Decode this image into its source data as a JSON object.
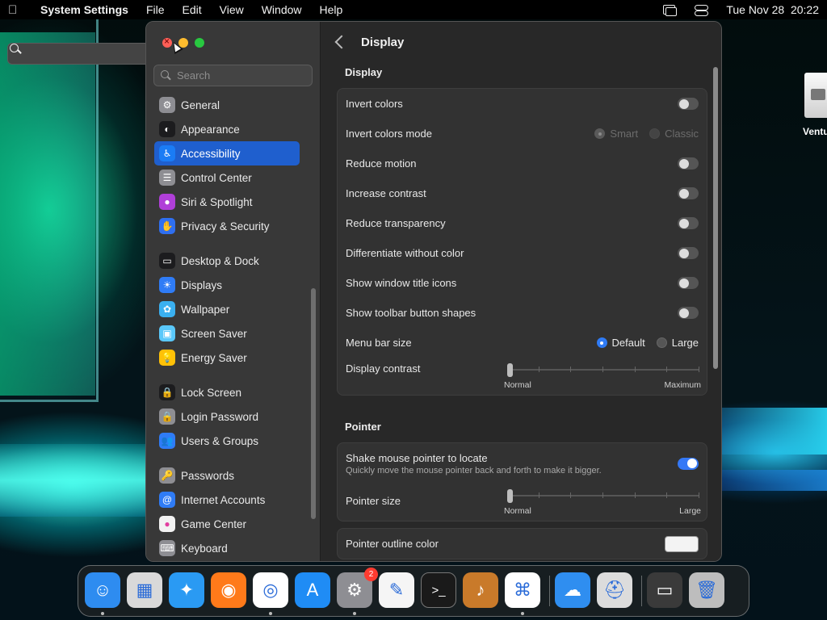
{
  "menubar": {
    "app_name": "System Settings",
    "menus": [
      "File",
      "Edit",
      "View",
      "Window",
      "Help"
    ],
    "clock": "Tue Nov 28  20:22"
  },
  "desktop": {
    "volume_label": "Ventur"
  },
  "sidebar": {
    "search_placeholder": "Search",
    "items": [
      {
        "label": "General",
        "icon": "gear-icon",
        "color": "#8e8e93"
      },
      {
        "label": "Appearance",
        "icon": "appearance-icon",
        "color": "#1c1c1e"
      },
      {
        "label": "Accessibility",
        "icon": "accessibility-icon",
        "color": "#1a7cf5",
        "active": true
      },
      {
        "label": "Control Center",
        "icon": "control-center-icon",
        "color": "#8e8e93"
      },
      {
        "label": "Siri & Spotlight",
        "icon": "siri-icon",
        "color": "#b03fd8"
      },
      {
        "label": "Privacy & Security",
        "icon": "hand-icon",
        "color": "#2f6ff0"
      },
      {
        "label": "Desktop & Dock",
        "icon": "dock-icon",
        "color": "#1c1c1e"
      },
      {
        "label": "Displays",
        "icon": "sun-icon",
        "color": "#2f7cf6"
      },
      {
        "label": "Wallpaper",
        "icon": "wallpaper-icon",
        "color": "#3ab0f0"
      },
      {
        "label": "Screen Saver",
        "icon": "screen-saver-icon",
        "color": "#5ac8fa"
      },
      {
        "label": "Energy Saver",
        "icon": "bulb-icon",
        "color": "#ffc107"
      },
      {
        "label": "Lock Screen",
        "icon": "lock-icon",
        "color": "#1c1c1e"
      },
      {
        "label": "Login Password",
        "icon": "lock-icon",
        "color": "#8e8e93"
      },
      {
        "label": "Users & Groups",
        "icon": "users-icon",
        "color": "#2f7cf6"
      },
      {
        "label": "Passwords",
        "icon": "key-icon",
        "color": "#8e8e93"
      },
      {
        "label": "Internet Accounts",
        "icon": "at-icon",
        "color": "#2f7cf6"
      },
      {
        "label": "Game Center",
        "icon": "game-center-icon",
        "color": "#f2f2f2"
      },
      {
        "label": "Keyboard",
        "icon": "keyboard-icon",
        "color": "#8e8e93"
      }
    ]
  },
  "main": {
    "title": "Display",
    "display_section": {
      "heading": "Display",
      "rows": [
        {
          "label": "Invert colors",
          "type": "toggle",
          "on": false
        },
        {
          "label": "Invert colors mode",
          "type": "radio",
          "options": [
            "Smart",
            "Classic"
          ],
          "selected": "Smart",
          "disabled": true
        },
        {
          "label": "Reduce motion",
          "type": "toggle",
          "on": false
        },
        {
          "label": "Increase contrast",
          "type": "toggle",
          "on": false
        },
        {
          "label": "Reduce transparency",
          "type": "toggle",
          "on": false
        },
        {
          "label": "Differentiate without color",
          "type": "toggle",
          "on": false
        },
        {
          "label": "Show window title icons",
          "type": "toggle",
          "on": false
        },
        {
          "label": "Show toolbar button shapes",
          "type": "toggle",
          "on": false
        },
        {
          "label": "Menu bar size",
          "type": "radio",
          "options": [
            "Default",
            "Large"
          ],
          "selected": "Default",
          "disabled": false
        }
      ],
      "contrast": {
        "label": "Display contrast",
        "min_label": "Normal",
        "max_label": "Maximum",
        "value": 0
      }
    },
    "pointer_section": {
      "heading": "Pointer",
      "shake": {
        "label": "Shake mouse pointer to locate",
        "description": "Quickly move the mouse pointer back and forth to make it bigger.",
        "on": true
      },
      "size": {
        "label": "Pointer size",
        "min_label": "Normal",
        "max_label": "Large",
        "value": 0
      },
      "outline": {
        "label": "Pointer outline color",
        "color": "#f3f3f3"
      }
    }
  },
  "dock": {
    "apps": [
      {
        "name": "Finder",
        "icon": "finder-icon",
        "color": "#2e8cf0",
        "running": true
      },
      {
        "name": "Launchpad",
        "icon": "launchpad-icon",
        "color": "#d9d9d9",
        "running": false
      },
      {
        "name": "Safari",
        "icon": "safari-icon",
        "color": "#2a9af3",
        "running": false
      },
      {
        "name": "Firefox",
        "icon": "firefox-icon",
        "color": "#ff7a1a",
        "running": false
      },
      {
        "name": "Chrome",
        "icon": "chrome-icon",
        "color": "#ffffff",
        "running": true
      },
      {
        "name": "App Store",
        "icon": "app-store-icon",
        "color": "#1f8cf5",
        "running": false
      },
      {
        "name": "System Settings",
        "icon": "gear-icon",
        "color": "#8e8e93",
        "running": true,
        "badge": "2"
      },
      {
        "name": "TextEdit",
        "icon": "textedit-icon",
        "color": "#f5f5f5",
        "running": false
      },
      {
        "name": "Terminal",
        "icon": "terminal-icon",
        "color": "#1a1a1a",
        "running": false
      },
      {
        "name": "GarageBand",
        "icon": "guitar-icon",
        "color": "#c97a2a",
        "running": false
      },
      {
        "name": "VS Code",
        "icon": "vscode-icon",
        "color": "#ffffff",
        "running": true
      },
      {
        "name": "iCloud Drive",
        "icon": "icloud-icon",
        "color": "#2f8ef0",
        "running": false
      },
      {
        "name": "Disk Utility",
        "icon": "disk-utility-icon",
        "color": "#dcdcdc",
        "running": false
      },
      {
        "name": "Recent Item",
        "icon": "window-icon",
        "color": "#3a3a3a",
        "running": false
      },
      {
        "name": "Trash",
        "icon": "trash-icon",
        "color": "#bdbdbd",
        "running": false
      }
    ]
  }
}
